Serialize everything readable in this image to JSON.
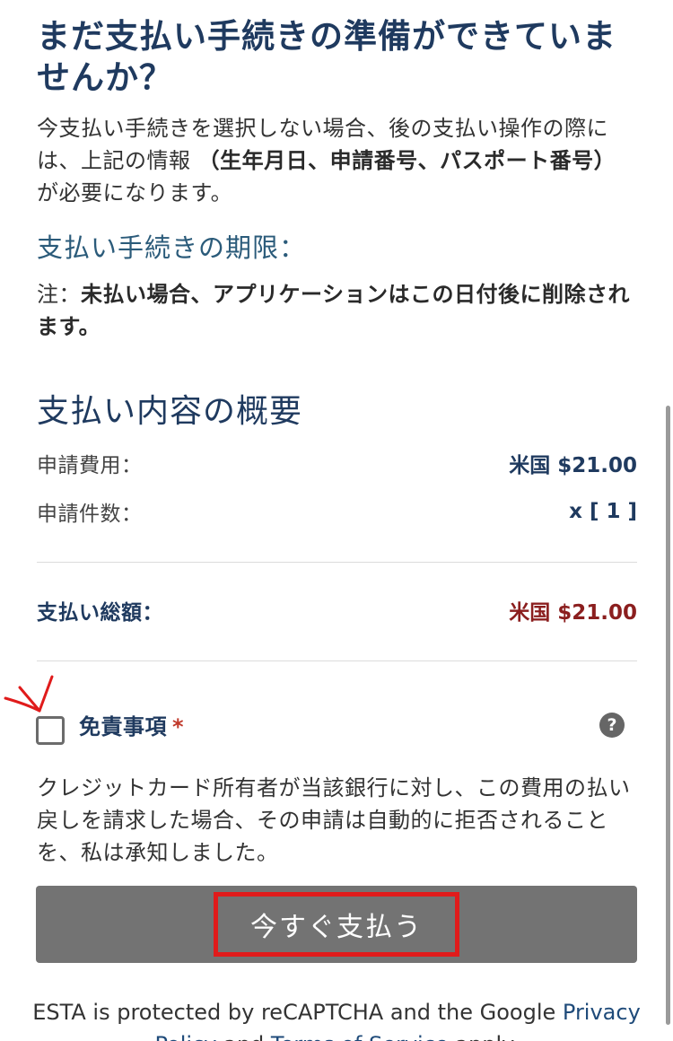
{
  "section_heading": "まだ支払い手続きの準備ができていませんか？",
  "intro": {
    "before": "今支払い手続きを選択しない場合、後の支払い操作の際には、上記の情報",
    "bold": "（生年月日、申請番号、パスポート番号）",
    "after": "が必要になります。"
  },
  "deadline": {
    "heading": "支払い手続きの期限：",
    "note_prefix": "注：",
    "note_bold": "未払い場合、アプリケーションはこの日付後に削除されます。"
  },
  "summary": {
    "heading": "支払い内容の概要",
    "fee_label": "申請費用：",
    "fee_value": "米国 $21.00",
    "count_label": "申請件数：",
    "count_value": "x [ 1 ]",
    "total_label": "支払い総額：",
    "total_value": "米国 $21.00"
  },
  "disclaimer": {
    "label": "免責事項",
    "required_mark": "*",
    "help_icon": "?",
    "checked": false,
    "text": "クレジットカード所有者が当該銀行に対し、この費用の払い戻しを請求した場合、その申請は自動的に拒否されることを、私は承知しました。"
  },
  "pay_button": {
    "label": "今すぐ支払う"
  },
  "footer": {
    "text_before": "ESTA is protected by reCAPTCHA and the Google ",
    "privacy_link": "Privacy Policy",
    "and": " and ",
    "terms_link": "Terms of Service",
    "text_after": " apply."
  },
  "colors": {
    "heading": "#1f3a5f",
    "total_value": "#8b1e1e",
    "pay_button_bg": "#737373",
    "annotation_red": "#e01b1b",
    "link": "#1f4b7a"
  },
  "icons": {
    "help": "question-circle-icon",
    "annotation": "red-arrow-annotation"
  }
}
